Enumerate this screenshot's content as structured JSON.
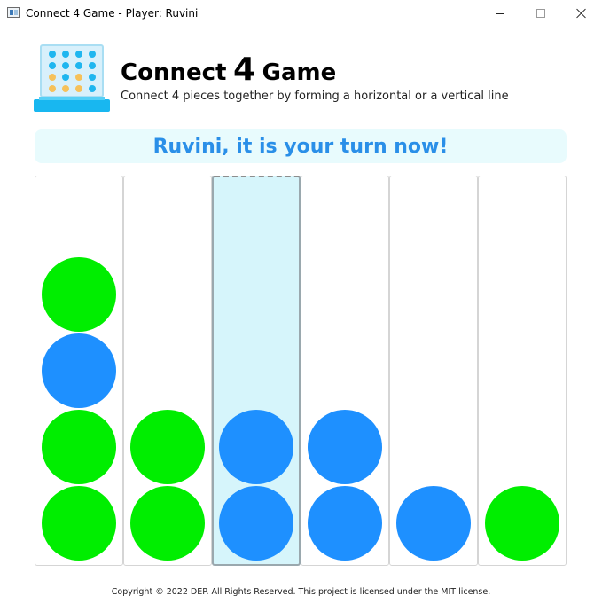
{
  "window": {
    "title": "Connect 4 Game - Player: Ruvini"
  },
  "header": {
    "title_part1": "Connect",
    "title_number": "4",
    "title_part2": "Game",
    "subtitle": "Connect 4 pieces together by forming a horizontal or a vertical line"
  },
  "status": {
    "message": "Ruvini, it is your turn now!"
  },
  "colors": {
    "green_piece": "#00ee00",
    "blue_piece": "#1e90ff",
    "banner_text": "#2a8fe8",
    "banner_bg": "#e8fbfd",
    "selected_column_bg": "#d6f5fb"
  },
  "board": {
    "rows": 5,
    "selected_column": 2,
    "columns": [
      [
        "green",
        "green",
        "blue",
        "green"
      ],
      [
        "green",
        "green"
      ],
      [
        "blue",
        "blue"
      ],
      [
        "blue",
        "blue"
      ],
      [
        "blue"
      ],
      [
        "green"
      ]
    ]
  },
  "footer": {
    "copyright": "Copyright © 2022 DEP. All Rights Reserved. This project is licensed under the MIT license."
  }
}
